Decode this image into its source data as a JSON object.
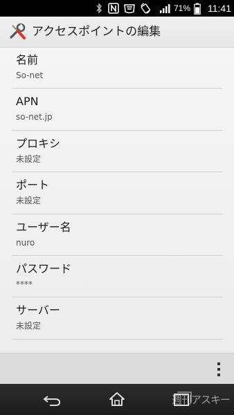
{
  "status_bar": {
    "battery_percent": "71%",
    "time": "11:41",
    "icons": [
      "bluetooth-icon",
      "nfc-icon",
      "wallet-icon",
      "rotate-icon",
      "signal-icon",
      "battery-icon"
    ]
  },
  "action_bar": {
    "title": "アクセスポイントの編集",
    "icon": "tools-icon"
  },
  "settings": [
    {
      "label": "名前",
      "value": "So-net"
    },
    {
      "label": "APN",
      "value": "so-net.jp"
    },
    {
      "label": "プロキシ",
      "value": "未設定"
    },
    {
      "label": "ポート",
      "value": "未設定"
    },
    {
      "label": "ユーザー名",
      "value": "nuro"
    },
    {
      "label": "パスワード",
      "value": "****"
    },
    {
      "label": "サーバー",
      "value": "未設定"
    }
  ],
  "bottom_bar": {
    "overflow_icon": "overflow-menu-icon"
  },
  "nav_bar": {
    "buttons": [
      "back-icon",
      "home-icon",
      "recent-apps-icon"
    ],
    "watermark": "週刊アスキー"
  }
}
